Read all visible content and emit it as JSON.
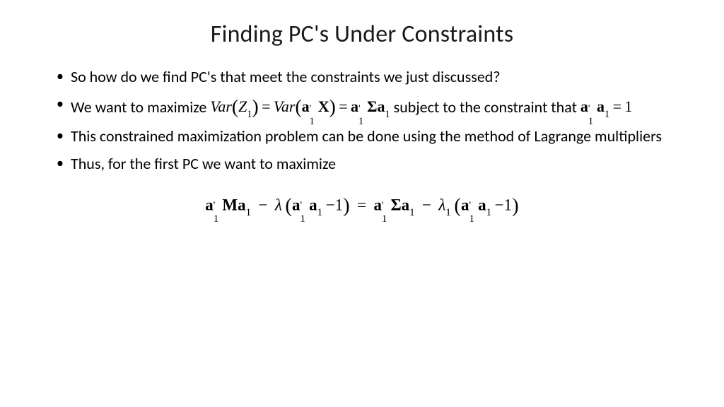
{
  "title": "Finding PC's Under Constraints",
  "bullets": [
    {
      "pre": "So how do we find PC's that meet the constraints we just discussed?"
    },
    {
      "pre": "We want to maximize ",
      "post": " subject to the constraint that  "
    },
    {
      "pre": "This constrained maximization problem can be done using the method of Lagrange multipliers"
    },
    {
      "pre": "Thus, for the first PC we want to maximize"
    }
  ],
  "math": {
    "var": "Var",
    "z1": "Z",
    "a": "a",
    "x": "X",
    "sigma": "Σ",
    "m": "M",
    "lambda": "λ",
    "one": "1",
    "eq": "=",
    "minus": "−",
    "sub1": "1",
    "prime": "'"
  }
}
